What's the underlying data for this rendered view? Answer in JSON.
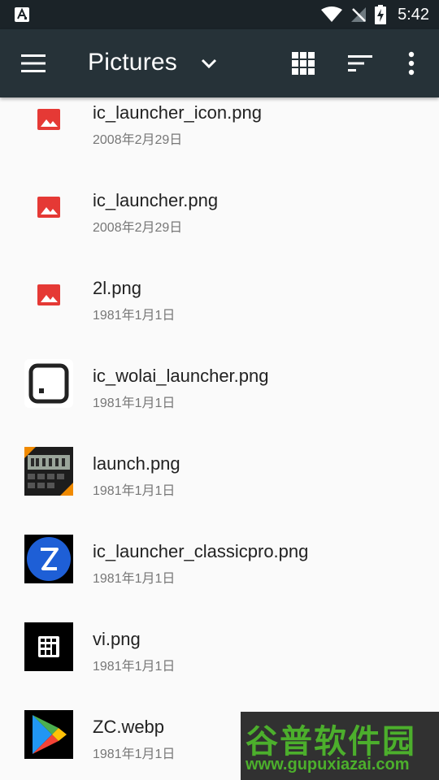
{
  "status_bar": {
    "time": "5:42"
  },
  "toolbar": {
    "title": "Pictures"
  },
  "files": [
    {
      "name": "ic_launcher_icon.png",
      "date": "2008年2月29日",
      "icon": "image-file-icon"
    },
    {
      "name": "ic_launcher.png",
      "date": "2008年2月29日",
      "icon": "image-file-icon"
    },
    {
      "name": "2l.png",
      "date": "1981年1月1日",
      "icon": "image-file-icon"
    },
    {
      "name": "ic_wolai_launcher.png",
      "date": "1981年1月1日",
      "icon": "wolai-thumbnail"
    },
    {
      "name": "launch.png",
      "date": "1981年1月1日",
      "icon": "calculator-thumbnail"
    },
    {
      "name": "ic_launcher_classicpro.png",
      "date": "1981年1月1日",
      "icon": "classicpro-thumbnail"
    },
    {
      "name": "vi.png",
      "date": "1981年1月1日",
      "icon": "vi-thumbnail"
    },
    {
      "name": "ZC.webp",
      "date": "1981年1月1日",
      "icon": "play-store-thumbnail"
    }
  ],
  "watermark": {
    "title": "谷普软件园",
    "url": "www.gupuxiazai.com"
  },
  "colors": {
    "toolbar": "#263238",
    "status_bar": "#1b2328",
    "image_icon": "#e53935",
    "watermark_green": "#4caf2c"
  }
}
